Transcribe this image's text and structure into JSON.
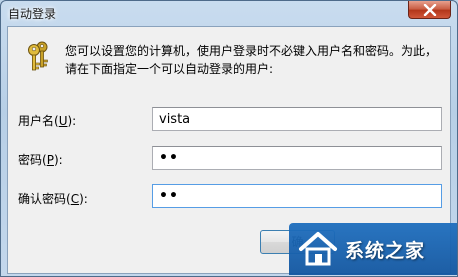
{
  "window": {
    "title": "自动登录"
  },
  "dialog": {
    "message_line1": "您可以设置您的计算机，使用户登录时不必键入用户名和密码。为此，",
    "message_line2": "请在下面指定一个可以自动登录的用户:",
    "username": {
      "label_prefix": "用户名(",
      "label_key": "U",
      "label_suffix": "):",
      "value": "vista"
    },
    "password": {
      "label_prefix": "密码(",
      "label_key": "P",
      "label_suffix": "):",
      "value": "••"
    },
    "confirm": {
      "label_prefix": "确认密码(",
      "label_key": "C",
      "label_suffix": "):",
      "value": "••"
    },
    "ok_button_label": "确"
  },
  "watermark": {
    "text": "系统之家"
  },
  "colors": {
    "title_bar": "#b7cfe6",
    "close_button": "#c75a3f",
    "focus_border": "#569de5",
    "watermark_bg": "#1e6ebe"
  },
  "icons": {
    "dialog_icon": "keys-icon",
    "close": "close-icon",
    "watermark_logo": "house-logo"
  }
}
